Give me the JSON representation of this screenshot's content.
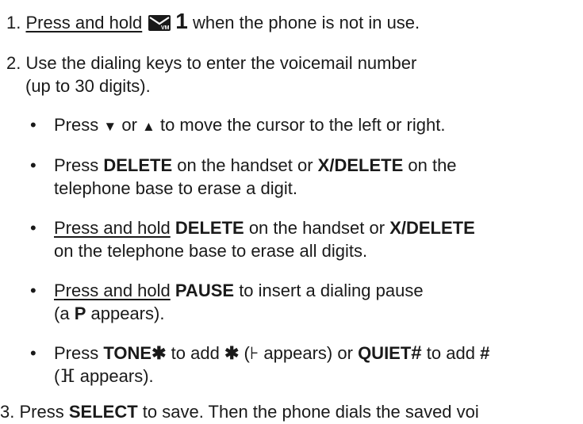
{
  "step1": {
    "number": "1.",
    "press_hold": "Press and hold",
    "key": "1",
    "rest": "when the phone is not in use."
  },
  "step2": {
    "number": "2.",
    "line1": "Use the dialing keys to enter the voicemail number",
    "line2": "(up to 30 digits).",
    "bullets": [
      {
        "pre": "Press",
        "down": "▼",
        "or": "or",
        "up": "▲",
        "rest": "to move the cursor to the left or right."
      },
      {
        "pre": "Press",
        "key1": "DELETE",
        "mid": "on the handset or",
        "key2": "X/DELETE",
        "post": "on the",
        "line2": "telephone base to erase a digit."
      },
      {
        "press_hold": "Press and hold",
        "key1": "DELETE",
        "mid": "on the handset or",
        "key2": "X/DELETE",
        "line2": "on the telephone base to erase all digits."
      },
      {
        "press_hold": "Press and hold",
        "key": "PAUSE",
        "rest": "to insert a dialing pause",
        "line2_pre": "(a",
        "line2_key": "P",
        "line2_post": "appears)."
      },
      {
        "pre": "Press",
        "key1": "TONE",
        "star_glyph": "✱",
        "mid1": "to add",
        "star_symbol": "✱",
        "mid2": "(",
        "star_display": "⊦",
        "mid3": "appears) or",
        "key2": "QUIET",
        "hash_glyph": "#",
        "mid4": "to add",
        "hash_symbol": "#",
        "line2_pre": "(",
        "hash_display": "ⴼ",
        "line2_post": "appears)."
      }
    ]
  },
  "step3": {
    "number": "3.",
    "pre": "Press",
    "key": "SELECT",
    "rest": "to save. Then the phone dials the saved voi"
  }
}
